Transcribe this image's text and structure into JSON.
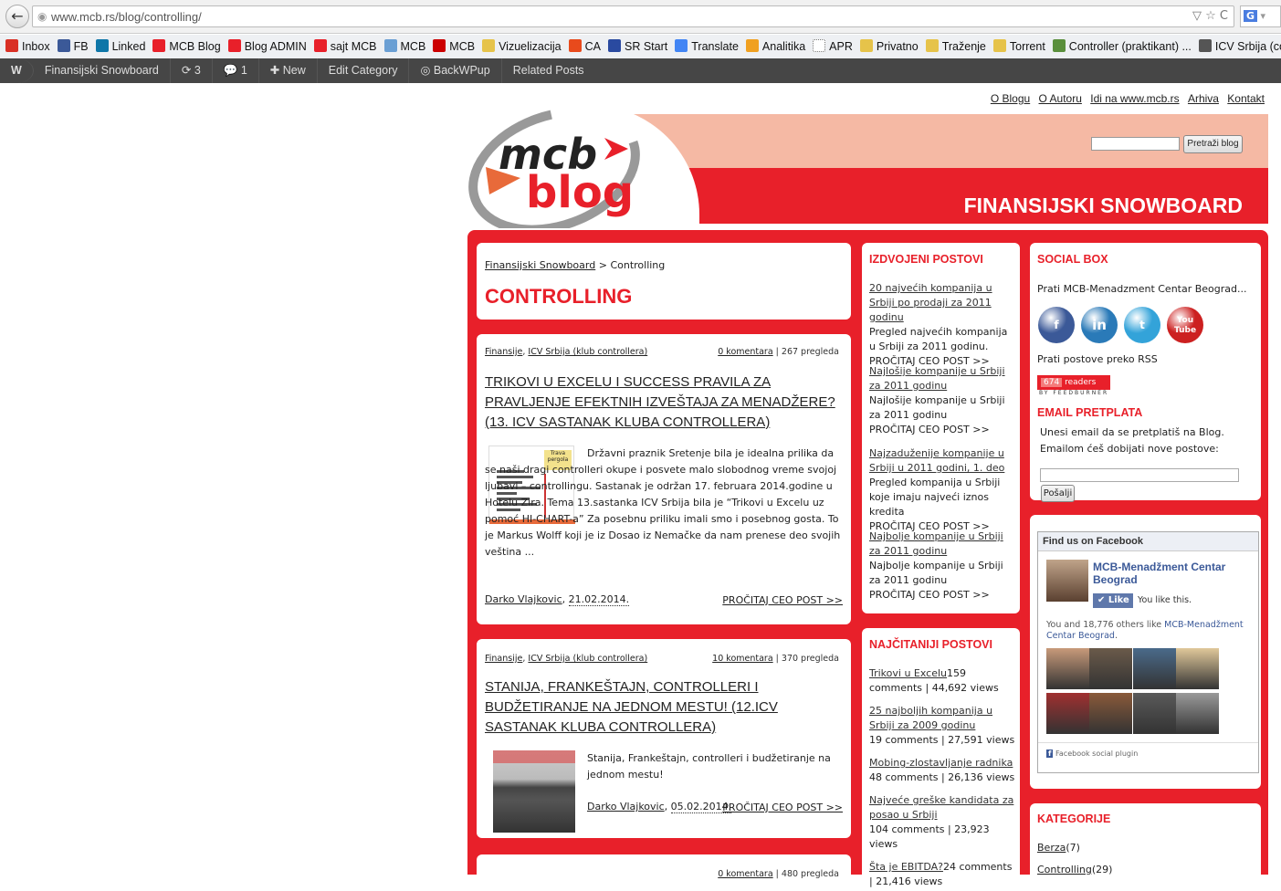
{
  "browser": {
    "back": "←",
    "url": "www.mcb.rs/blog/controlling/",
    "url_actions": "▽ ☆ C",
    "search_hint": "G"
  },
  "bookmarks": [
    {
      "label": "Inbox",
      "color": "#d93025"
    },
    {
      "label": "FB",
      "color": "#3b5998"
    },
    {
      "label": "Linked",
      "color": "#0e76a8"
    },
    {
      "label": "MCB Blog",
      "color": "#e8202a"
    },
    {
      "label": "Blog ADMIN",
      "color": "#e8202a"
    },
    {
      "label": "sajt MCB",
      "color": "#e8202a"
    },
    {
      "label": "MCB",
      "color": "#6a9fd4"
    },
    {
      "label": "MCB",
      "color": "#cc0000"
    },
    {
      "label": "Vizuelizacija",
      "color": "#e6c34a"
    },
    {
      "label": "CA",
      "color": "#e84a1c"
    },
    {
      "label": "SR Start",
      "color": "#2a4aa0"
    },
    {
      "label": "Translate",
      "color": "#4285f4"
    },
    {
      "label": "Analitika",
      "color": "#f0a020"
    },
    {
      "label": "APR",
      "color": "#ffffff"
    },
    {
      "label": "Privatno",
      "color": "#e6c34a"
    },
    {
      "label": "Traženje",
      "color": "#e6c34a"
    },
    {
      "label": "Torrent",
      "color": "#e6c34a"
    },
    {
      "label": "Controller (praktikant) ...",
      "color": "#5a8f3c"
    },
    {
      "label": "ICV Srbija (controllin",
      "color": "#555555"
    }
  ],
  "wpbar": {
    "logo": "W",
    "site": "Finansijski Snowboard",
    "updates": "3",
    "comments": "1",
    "new": "New",
    "edit": "Edit Category",
    "backwpup": "BackWPup",
    "related": "Related Posts"
  },
  "toplinks": [
    "O Blogu",
    "O Autoru",
    "Idi na www.mcb.rs",
    "Arhiva",
    "Kontakt"
  ],
  "header": {
    "logo_top": "mcb",
    "logo_bottom": "blog",
    "search_button": "Pretraži blog",
    "title": "FINANSIJSKI SNOWBOARD"
  },
  "breadcrumb": {
    "parent": "Finansijski Snowboard",
    "sep": " > ",
    "current": "Controlling"
  },
  "category_title": "CONTROLLING",
  "posts": [
    {
      "cat1": "Finansije",
      "cat2": "ICV Srbija (klub controllera)",
      "comments": "0 komentara",
      "views": "267 pregleda",
      "title": "TRIKOVI U EXCELU I SUCCESS PRAVILA ZA PRAVLJENJE EFEKTNIH IZVEŠTAJA ZA MENADŽERE? (13. ICV SASTANAK KLUBA CONTROLLERA)",
      "excerpt": "Državni praznik Sretenje bila je idealna prilika da se naši dragi controlleri okupe i posvete malo slobodnog vreme svojoj ljubavi – controllingu. Sastanak je održan 17. februara 2014.godine u Hotelu Zira. Tema 13.sastanka ICV Srbija bila je “Trikovi u Excelu uz pomoć HI-CHART-a” Za posebnu priliku imali smo i posebnog gosta. To je Markus Wolff koji je iz Dosao iz Nemačke da nam prenese deo svojih veština ...",
      "author": "Darko Vlajkovic",
      "date": "21.02.2014.",
      "more": "PROČITAJ CEO POST >>",
      "thumb_label": "Trava pergola"
    },
    {
      "cat1": "Finansije",
      "cat2": "ICV Srbija (klub controllera)",
      "comments": "10 komentara",
      "views": "370 pregleda",
      "title": "STANIJA, FRANKEŠTAJN, CONTROLLERI I BUDŽETIRANJE NA JEDNOM MESTU! (12.ICV SASTANAK KLUBA CONTROLLERA)",
      "excerpt": "Stanija, Frankeštajn, controlleri i budžetiranje na jednom mestu!",
      "author": "Darko Vlajkovic",
      "date": "05.02.2014.",
      "more": "PROČITAJ CEO POST >>"
    },
    {
      "comments": "0 komentara",
      "views": "480 pregleda"
    }
  ],
  "featured": {
    "title": "IZDVOJENI POSTOVI",
    "items": [
      {
        "link": "20 najvećih kompanija u Srbiji po prodaji za 2011 godinu",
        "text": "Pregled najvećih kompanija u Srbiji za 2011 godinu.",
        "more": "PROČITAJ CEO POST >>"
      },
      {
        "link": "Najlošije kompanije u Srbiji za 2011 godinu",
        "text": "Najlošije kompanije u Srbiji za 2011 godinu",
        "more": "PROČITAJ CEO POST >>"
      },
      {
        "link": "Najzaduženije kompanije u Srbiji u 2011 godini, 1. deo",
        "text": "Pregled kompanija u Srbiji koje imaju najveći iznos kredita",
        "more": "PROČITAJ CEO POST >>"
      },
      {
        "link": "Najbolje kompanije u Srbiji za 2011 godinu",
        "text": "Najbolje kompanije u Srbiji za 2011 godinu",
        "more": "PROČITAJ CEO POST >>"
      }
    ]
  },
  "popular": {
    "title": "NAJČITANIJI POSTOVI",
    "items": [
      {
        "link": "Trikovi u Excelu",
        "stats": "159 comments | 44,692 views"
      },
      {
        "link": "25 najboljih kompanija u Srbiji za 2009 godinu",
        "stats": "19 comments | 27,591 views"
      },
      {
        "link": "Mobing-zlostavljanje radnika",
        "stats": "48 comments | 26,136 views"
      },
      {
        "link": "Najveće greške kandidata za posao u Srbiji",
        "stats": "104 comments | 23,923 views"
      },
      {
        "link": "Šta je EBITDA?",
        "stats": "24 comments | 21,416 views"
      }
    ]
  },
  "socialbox": {
    "title": "SOCIAL BOX",
    "follow": "Prati MCB-Menadzment Centar Beograd...",
    "rss": "Prati postove preko RSS",
    "readers_count": "674",
    "readers_label": "readers",
    "feedburner": "BY FEEDBURNER",
    "email_title": "EMAIL PRETPLATA",
    "email_text1": "Unesi email da se pretplatiš na Blog.",
    "email_text2": "Emailom ćeš dobijati nove postove:",
    "send": "Pošalji",
    "icons": [
      {
        "label": "f",
        "color": "#3b5998"
      },
      {
        "label": "in",
        "color": "#2a7ab8"
      },
      {
        "label": "t",
        "color": "#33a3d9"
      },
      {
        "label": "You Tube",
        "color": "#cc2020"
      }
    ]
  },
  "facebook": {
    "header": "Find us on Facebook",
    "page_name": "MCB-Menadžment Centar Beograd",
    "like": "Like",
    "you_like": "You like this.",
    "others_prefix": "You and 18,776 others like ",
    "others_name": "MCB-Menadžment Centar Beograd",
    "others_suffix": ".",
    "plugin": "Facebook social plugin",
    "face_colors": [
      "#c89a7a",
      "#6a5a4a",
      "#4a6a8a",
      "#e0c89a",
      "#a03030",
      "#8a5a3a",
      "#5a5a5a",
      "#9a9a9a"
    ]
  },
  "categories": {
    "title": "KATEGORIJE",
    "items": [
      {
        "label": "Berza",
        "count": "(7)"
      },
      {
        "label": "Controlling",
        "count": "(29)"
      }
    ]
  }
}
